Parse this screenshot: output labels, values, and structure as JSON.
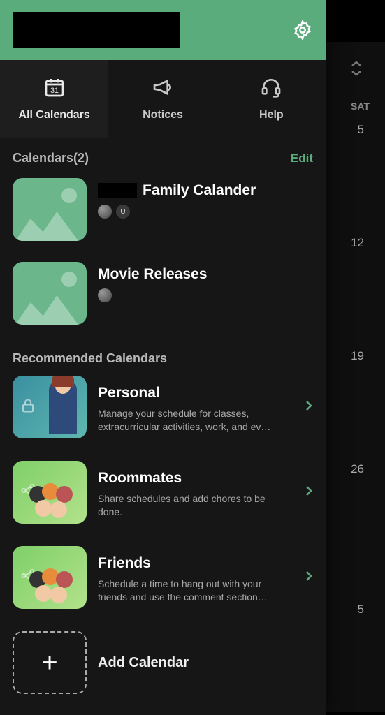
{
  "header": {
    "settings_icon": "gear"
  },
  "tabs": {
    "all_calendars": "All Calendars",
    "notices": "Notices",
    "help": "Help"
  },
  "calendars_section": {
    "title": "Calendars(2)",
    "edit": "Edit"
  },
  "calendars": [
    {
      "name_suffix": "Family Calander",
      "avatars": [
        "img",
        "U"
      ]
    },
    {
      "name": "Movie Releases",
      "avatars": [
        "img"
      ]
    }
  ],
  "recommended_section": {
    "title": "Recommended Calendars"
  },
  "recommended": [
    {
      "title": "Personal",
      "desc": "Manage your schedule for classes, extracurricular activities, work, and ev…"
    },
    {
      "title": "Roommates",
      "desc": "Share schedules and add chores to be done."
    },
    {
      "title": "Friends",
      "desc": "Schedule a time to hang out with your friends and use the comment section…"
    }
  ],
  "add_calendar": "Add Calendar",
  "background_calendar": {
    "day_label": "SAT",
    "dates": [
      "5",
      "12",
      "19",
      "26",
      "5"
    ]
  }
}
